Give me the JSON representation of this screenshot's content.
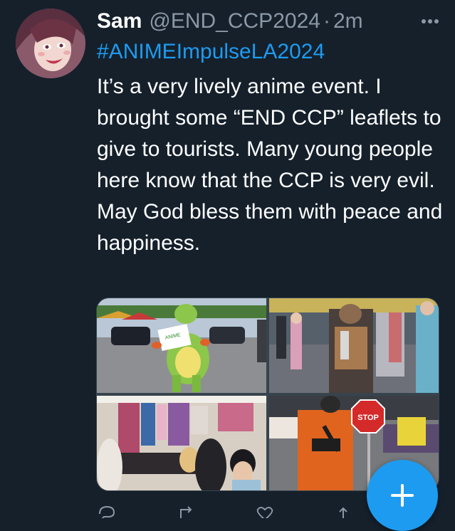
{
  "tweet": {
    "author_name": "Sam",
    "handle": "@END_CCP2024",
    "separator": "·",
    "time": "2m",
    "hashtag": "#ANIMEImpulseLA2024",
    "text": "It’s a very lively anime event. I brought some “END CCP” leaflets to give to tourists. Many young people here know that the CCP is very evil. May God bless them with peace and happiness."
  },
  "media": {
    "photos": [
      {
        "subject": "mascot costume holding sign in parking lot",
        "sign_text": "ANIME ENTHUSIASM"
      },
      {
        "subject": "cosplayers in armor at convention"
      },
      {
        "subject": "vendor booth with merchandise and crowd"
      },
      {
        "subject": "orange jumpsuit cosplayer with stop sign",
        "sign_text": "STOP"
      }
    ]
  },
  "actions": {
    "icons": [
      "reply-icon",
      "retweet-icon",
      "like-icon",
      "share-icon"
    ]
  },
  "fab": {
    "icon": "plus-icon"
  },
  "colors": {
    "background": "#15202b",
    "link": "#1d9bf0",
    "secondary_text": "#8b98a5",
    "border": "#38444d"
  }
}
